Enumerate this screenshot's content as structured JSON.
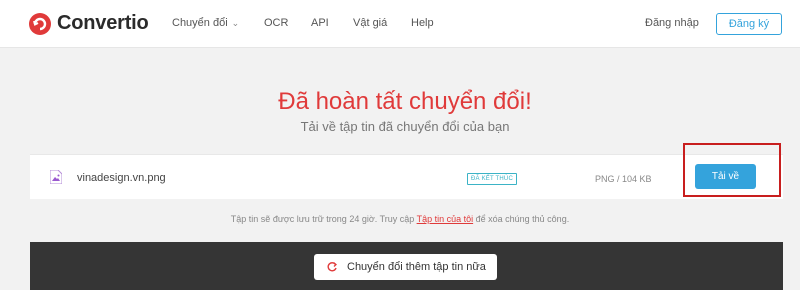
{
  "brand": {
    "name": "Convertio",
    "color": "#e03a3a"
  },
  "nav": {
    "items": [
      {
        "label": "Chuyển đổi",
        "has_dropdown": true
      },
      {
        "label": "OCR"
      },
      {
        "label": "API"
      },
      {
        "label": "Vật giá"
      },
      {
        "label": "Help"
      }
    ],
    "login": "Đăng nhập",
    "signup": "Đăng ký"
  },
  "main": {
    "title": "Đã hoàn tất chuyển đổi!",
    "subtitle": "Tải về tập tin đã chuyển đổi của bạn"
  },
  "file": {
    "icon": "image-file-icon",
    "name": "vinadesign.vn.png",
    "status": "ĐÃ KẾT THÚC",
    "info": "PNG / 104 KB",
    "download_label": "Tải về"
  },
  "note": {
    "before": "Tập tin sẽ được lưu trữ trong 24 giờ. Truy cập ",
    "link": "Tập tin của tôi",
    "after": " để xóa chúng thủ công."
  },
  "actions": {
    "more_label": "Chuyển đổi thêm tập tin nữa"
  },
  "colors": {
    "accent_blue": "#34a3dc",
    "badge_teal": "#3bb3c6",
    "highlight_red": "#c81e1e",
    "dark_band": "#353535"
  }
}
